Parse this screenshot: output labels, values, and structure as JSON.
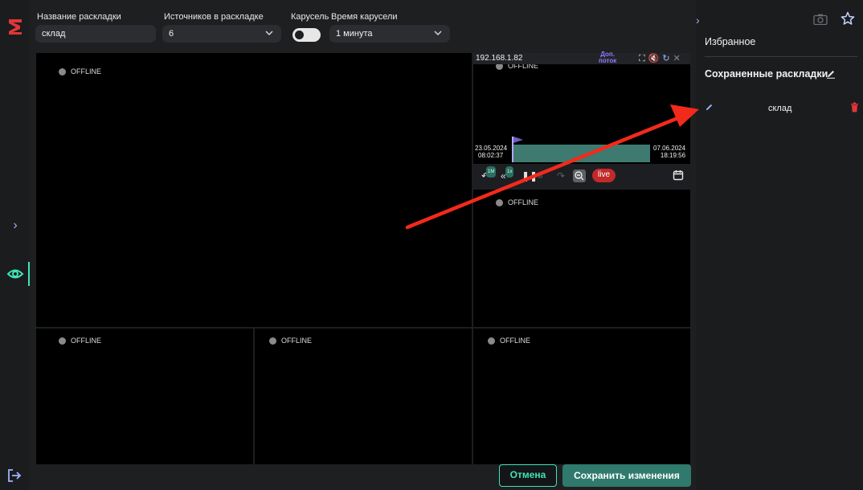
{
  "toolbar": {
    "layout_name_label": "Название раскладки",
    "layout_name_value": "склад",
    "sources_label": "Источников в раскладке",
    "sources_value": "6",
    "carousel_label": "Карусель",
    "carousel_enabled": false,
    "carousel_time_label": "Время карусели",
    "carousel_time_value": "1 минута"
  },
  "grid": {
    "offline_text": "OFFLINE",
    "camera": {
      "ip": "192.168.1.82",
      "stream_label_1": "Доп.",
      "stream_label_2": "поток",
      "timeline_start_date": "23.05.2024",
      "timeline_start_time": "08:02:37",
      "timeline_end_date": "07.06.2024",
      "timeline_end_time": "18:19:56",
      "rewind_badge": "1M",
      "speed_badge": "1x",
      "live_label": "live"
    }
  },
  "actions": {
    "cancel_label": "Отмена",
    "save_label": "Сохранить изменения"
  },
  "panel": {
    "favorites_title": "Избранное",
    "saved_layouts_title": "Сохраненные раскладки",
    "layouts": [
      {
        "name": "склад"
      }
    ]
  },
  "colors": {
    "accent": "#3ee6b8",
    "save_button": "#2f7a6c",
    "live": "#c2292b",
    "annotation_arrow": "#f22a1c",
    "delete": "#e0363a",
    "stream_link": "#8a7cff"
  },
  "icons": {
    "logo": "logo-icon",
    "expand": "chevron-right-icon",
    "eye": "eye-icon",
    "logout": "logout-icon",
    "snapshot": "camera-icon",
    "favorite": "star-icon",
    "edit": "pencil-icon",
    "delete": "trash-icon",
    "calendar": "calendar-icon"
  }
}
